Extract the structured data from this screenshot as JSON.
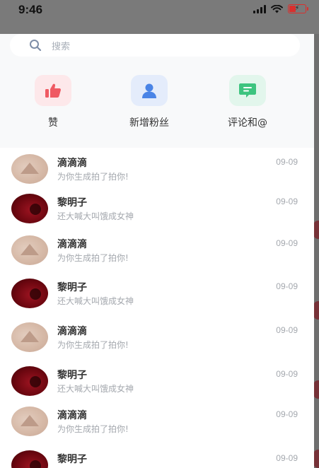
{
  "status_bar": {
    "time": "9:46"
  },
  "search": {
    "placeholder": "搜索",
    "icon": "search-icon"
  },
  "shortcuts": [
    {
      "label": "赞",
      "icon": "thumbs-up-icon",
      "bg": "#fde8ea",
      "fg": "#ef5a63"
    },
    {
      "label": "新增粉丝",
      "icon": "user-icon",
      "bg": "#e4ecfb",
      "fg": "#4a84e6"
    },
    {
      "label": "评论和@",
      "icon": "comment-icon",
      "bg": "#e2f6ec",
      "fg": "#3dc47f"
    }
  ],
  "messages": [
    {
      "name": "滴滴滴",
      "text": "为你生成拍了拍你!",
      "date": "09-09"
    },
    {
      "name": "黎明子",
      "text": "还大喊大叫饿成女神",
      "date": "09-09"
    },
    {
      "name": "滴滴滴",
      "text": "为你生成拍了拍你!",
      "date": "09-09"
    },
    {
      "name": "黎明子",
      "text": "还大喊大叫饿成女神",
      "date": "09-09"
    },
    {
      "name": "滴滴滴",
      "text": "为你生成拍了拍你!",
      "date": "09-09"
    },
    {
      "name": "黎明子",
      "text": "还大喊大叫饿成女神",
      "date": "09-09"
    },
    {
      "name": "滴滴滴",
      "text": "为你生成拍了拍你!",
      "date": "09-09"
    },
    {
      "name": "黎明子",
      "text": "",
      "date": "09-09"
    }
  ]
}
